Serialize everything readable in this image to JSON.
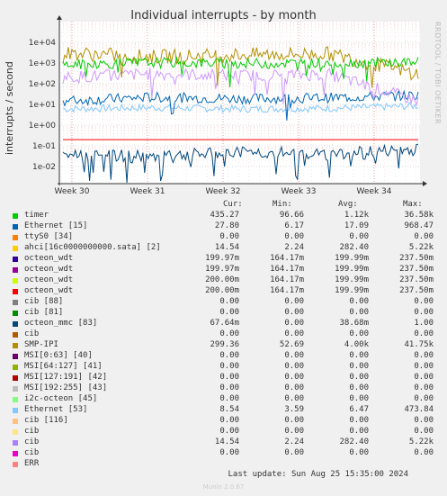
{
  "chart_data": {
    "type": "line",
    "title": "Individual interrupts - by month",
    "ylabel": "interrupts / second",
    "yscale": "log",
    "y_ticks": [
      "1e+04",
      "1e+03",
      "1e+02",
      "1e+01",
      "1e+00",
      "1e-01",
      "1e-02"
    ],
    "x_ticks": [
      "Week 30",
      "Week 31",
      "Week 32",
      "Week 33",
      "Week 34"
    ],
    "grid": true,
    "series_colors": {
      "timer": "#00cc00",
      "ethernet15": "#0066b3",
      "octeon_mmc": "#00487d",
      "smp_ipi": "#b38f00",
      "ethernet53": "#80c9ff",
      "cib": "#cc99ff"
    },
    "series": [
      {
        "name": "timer",
        "values": [
          800,
          1050,
          950,
          1000,
          1100
        ]
      },
      {
        "name": "Ethernet [15]",
        "values": [
          15,
          22,
          19,
          21,
          27.8
        ]
      },
      {
        "name": "octeon_mmc [83]",
        "values": [
          0.04,
          0.03,
          0.05,
          0.04,
          0.0676
        ]
      },
      {
        "name": "SMP-IPI",
        "values": [
          3000,
          2000,
          2500,
          2800,
          299
        ]
      },
      {
        "name": "Ethernet [53]",
        "values": [
          6,
          7,
          6,
          6.5,
          8.54
        ]
      },
      {
        "name": "cib",
        "values": [
          200,
          300,
          250,
          280,
          14.54
        ]
      }
    ]
  },
  "watermark": "RRDTOOL / TOBI OETIKER",
  "columns": {
    "cur": "Cur:",
    "min": "Min:",
    "avg": "Avg:",
    "max": "Max:"
  },
  "legend": [
    {
      "name": "timer",
      "color": "#00cc00",
      "cur": "435.27",
      "min": "96.66",
      "avg": "1.12k",
      "max": "36.58k"
    },
    {
      "name": "Ethernet [15]",
      "color": "#0066b3",
      "cur": "27.80",
      "min": "6.17",
      "avg": "17.09",
      "max": "968.47"
    },
    {
      "name": "ttyS0 [34]",
      "color": "#ff8000",
      "cur": "0.00",
      "min": "0.00",
      "avg": "0.00",
      "max": "0.00"
    },
    {
      "name": "ahci[16c0000000000.sata] [2]",
      "color": "#ffcc00",
      "cur": "14.54",
      "min": "2.24",
      "avg": "282.40",
      "max": "5.22k"
    },
    {
      "name": "octeon_wdt",
      "color": "#330099",
      "cur": "199.97m",
      "min": "164.17m",
      "avg": "199.99m",
      "max": "237.50m"
    },
    {
      "name": "octeon_wdt",
      "color": "#990099",
      "cur": "199.97m",
      "min": "164.17m",
      "avg": "199.99m",
      "max": "237.50m"
    },
    {
      "name": "octeon_wdt",
      "color": "#ccff00",
      "cur": "200.00m",
      "min": "164.17m",
      "avg": "199.99m",
      "max": "237.50m"
    },
    {
      "name": "octeon_wdt",
      "color": "#ff0000",
      "cur": "200.00m",
      "min": "164.17m",
      "avg": "199.99m",
      "max": "237.50m"
    },
    {
      "name": "cib [88]",
      "color": "#808080",
      "cur": "0.00",
      "min": "0.00",
      "avg": "0.00",
      "max": "0.00"
    },
    {
      "name": "cib [81]",
      "color": "#008f00",
      "cur": "0.00",
      "min": "0.00",
      "avg": "0.00",
      "max": "0.00"
    },
    {
      "name": "octeon_mmc [83]",
      "color": "#00487d",
      "cur": "67.64m",
      "min": "0.00",
      "avg": "38.68m",
      "max": "1.00"
    },
    {
      "name": "cib",
      "color": "#b35a00",
      "cur": "0.00",
      "min": "0.00",
      "avg": "0.00",
      "max": "0.00"
    },
    {
      "name": "SMP-IPI",
      "color": "#b38f00",
      "cur": "299.36",
      "min": "52.69",
      "avg": "4.00k",
      "max": "41.75k"
    },
    {
      "name": "MSI[0:63] [40]",
      "color": "#6b006b",
      "cur": "0.00",
      "min": "0.00",
      "avg": "0.00",
      "max": "0.00"
    },
    {
      "name": "MSI[64:127] [41]",
      "color": "#8fb300",
      "cur": "0.00",
      "min": "0.00",
      "avg": "0.00",
      "max": "0.00"
    },
    {
      "name": "MSI[127:191] [42]",
      "color": "#b30000",
      "cur": "0.00",
      "min": "0.00",
      "avg": "0.00",
      "max": "0.00"
    },
    {
      "name": "MSI[192:255] [43]",
      "color": "#bebebe",
      "cur": "0.00",
      "min": "0.00",
      "avg": "0.00",
      "max": "0.00"
    },
    {
      "name": "i2c-octeon [45]",
      "color": "#80ff80",
      "cur": "0.00",
      "min": "0.00",
      "avg": "0.00",
      "max": "0.00"
    },
    {
      "name": "Ethernet [53]",
      "color": "#80c9ff",
      "cur": "8.54",
      "min": "3.59",
      "avg": "6.47",
      "max": "473.84"
    },
    {
      "name": "cib [116]",
      "color": "#ffc080",
      "cur": "0.00",
      "min": "0.00",
      "avg": "0.00",
      "max": "0.00"
    },
    {
      "name": "cib",
      "color": "#ffe680",
      "cur": "0.00",
      "min": "0.00",
      "avg": "0.00",
      "max": "0.00"
    },
    {
      "name": "cib",
      "color": "#aa80ff",
      "cur": "14.54",
      "min": "2.24",
      "avg": "282.40",
      "max": "5.22k"
    },
    {
      "name": "cib",
      "color": "#ee00cc",
      "cur": "0.00",
      "min": "0.00",
      "avg": "0.00",
      "max": "0.00"
    },
    {
      "name": "ERR",
      "color": "#ff8080",
      "cur": "",
      "min": "",
      "avg": "",
      "max": ""
    }
  ],
  "last_update": "Last update: Sun Aug 25 15:35:00 2024",
  "munin_version": "Munin 2.0.67"
}
